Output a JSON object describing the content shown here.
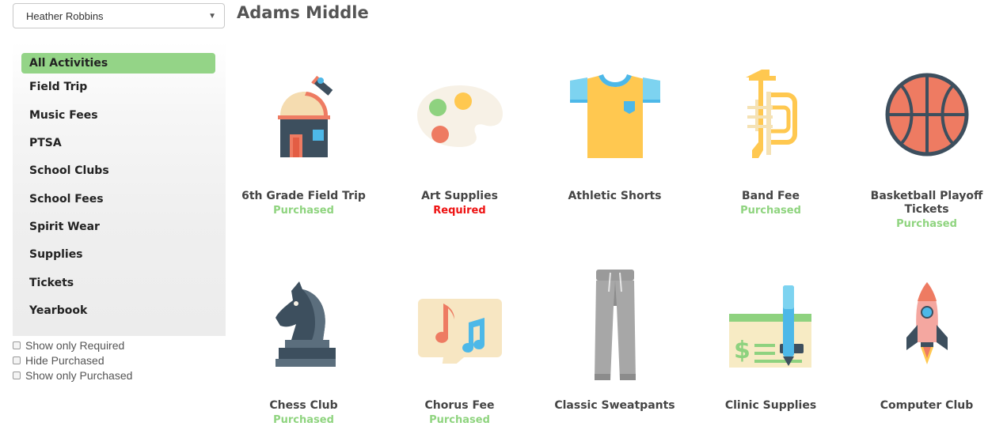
{
  "student_select": {
    "value": "Heather Robbins"
  },
  "school": {
    "name": "Adams Middle"
  },
  "sidebar": {
    "items": [
      {
        "label": "All Activities",
        "active": true
      },
      {
        "label": "Field Trip"
      },
      {
        "label": "Music Fees"
      },
      {
        "label": "PTSA"
      },
      {
        "label": "School Clubs"
      },
      {
        "label": "School Fees"
      },
      {
        "label": "Spirit Wear"
      },
      {
        "label": "Supplies"
      },
      {
        "label": "Tickets"
      },
      {
        "label": "Yearbook"
      }
    ]
  },
  "filters": [
    {
      "label": "Show only Required",
      "checked": false
    },
    {
      "label": "Hide Purchased",
      "checked": false
    },
    {
      "label": "Show only Purchased",
      "checked": false
    }
  ],
  "activities": [
    {
      "name": "6th Grade Field Trip",
      "status": "Purchased",
      "icon": "observatory-icon"
    },
    {
      "name": "Art Supplies",
      "status": "Required",
      "icon": "palette-icon"
    },
    {
      "name": "Athletic Shorts",
      "status": "",
      "icon": "shirt-icon"
    },
    {
      "name": "Band Fee",
      "status": "Purchased",
      "icon": "trumpet-icon"
    },
    {
      "name": "Basketball Playoff Tickets",
      "status": "Purchased",
      "icon": "basketball-icon"
    },
    {
      "name": "Chess Club",
      "status": "Purchased",
      "icon": "chess-knight-icon"
    },
    {
      "name": "Chorus Fee",
      "status": "Purchased",
      "icon": "music-note-bubble-icon"
    },
    {
      "name": "Classic Sweatpants",
      "status": "",
      "icon": "sweatpants-icon"
    },
    {
      "name": "Clinic Supplies",
      "status": "",
      "icon": "check-pen-icon"
    },
    {
      "name": "Computer Club",
      "status": "",
      "icon": "rocket-icon"
    }
  ],
  "colors": {
    "active_category": "#94d487",
    "purchased": "#8fd47f",
    "required": "#ee1111"
  }
}
